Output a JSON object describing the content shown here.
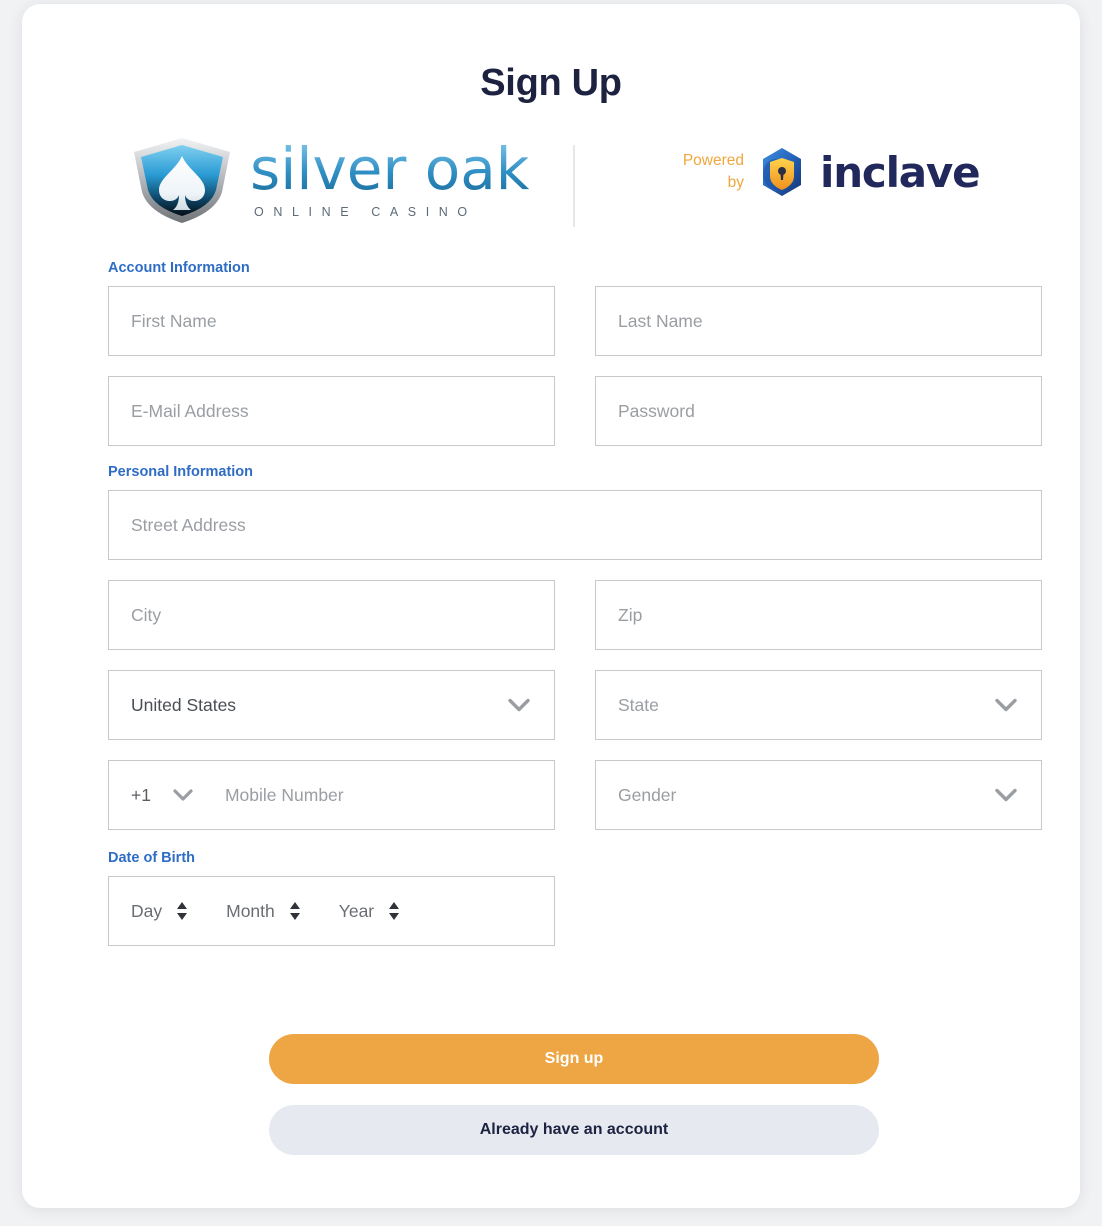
{
  "page": {
    "title": "Sign Up"
  },
  "brand": {
    "casino_name": "silver oak",
    "casino_tagline": "ONLINE CASINO",
    "powered_line1": "Powered",
    "powered_line2": "by",
    "partner_name": "inclave",
    "accent_blue": "#2f8fc4",
    "accent_orange": "#f0a73c",
    "partner_navy": "#21295c"
  },
  "sections": {
    "account": "Account Information",
    "personal": "Personal Information",
    "dob": "Date of Birth"
  },
  "fields": {
    "first_name": "First Name",
    "last_name": "Last Name",
    "email": "E-Mail Address",
    "password": "Password",
    "street": "Street Address",
    "city": "City",
    "zip": "Zip",
    "country": "United States",
    "state": "State",
    "phone_code": "+1",
    "mobile": "Mobile Number",
    "gender": "Gender"
  },
  "dob": {
    "day": "Day",
    "month": "Month",
    "year": "Year"
  },
  "buttons": {
    "signup": "Sign up",
    "existing": "Already have an account",
    "signup_color": "#eea644",
    "existing_color": "#e6eaf0"
  }
}
